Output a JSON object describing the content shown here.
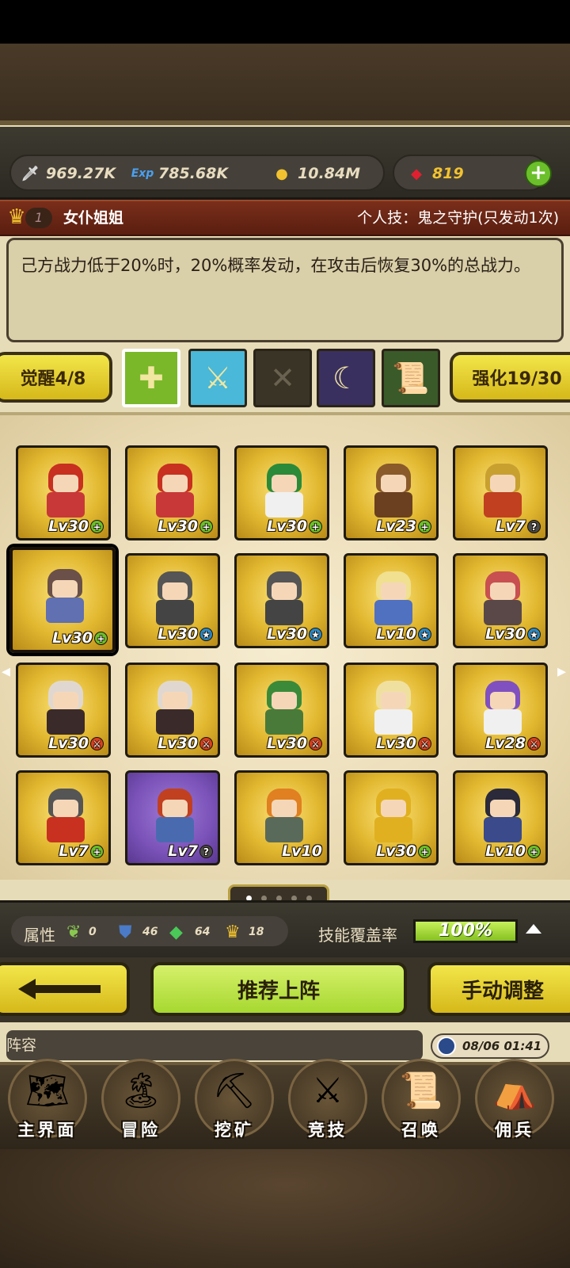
{
  "resources": {
    "power": "969.27K",
    "exp": "785.68K",
    "gold": "10.84M",
    "gems": "819",
    "power_icon": "sword-icon",
    "exp_icon": "exp-icon",
    "gold_icon": "coin-icon",
    "gem_icon": "ruby-icon"
  },
  "hero": {
    "rank": "1",
    "name": "女仆姐姐",
    "skill_title": "个人技：鬼之守护(只发动1次)",
    "description": "己方战力低于20%时，20%概率发动，在攻击后恢复30%的总战力。"
  },
  "awaken": {
    "label": "觉醒4/8"
  },
  "enhance": {
    "label": "强化19/30"
  },
  "skill_slots": [
    {
      "name": "golden-cross-icon",
      "color": "#7ab82a",
      "selected": true
    },
    {
      "name": "magic-sword-icon",
      "color": "#4ab8d8",
      "selected": false
    },
    {
      "name": "empty-slot-icon",
      "color": "#3a3426",
      "selected": false
    },
    {
      "name": "purple-horn-icon",
      "color": "#3a3060",
      "selected": false
    },
    {
      "name": "scroll-icon",
      "color": "#3a5a2a",
      "selected": false
    }
  ],
  "heroes": [
    {
      "lv": "Lv30",
      "badge": "plus",
      "hair": "#c83020",
      "body": "#c83838"
    },
    {
      "lv": "Lv30",
      "badge": "plus",
      "hair": "#c83020",
      "body": "#c83838"
    },
    {
      "lv": "Lv30",
      "badge": "plus",
      "hair": "#2a8a3a",
      "body": "#f0f0f0"
    },
    {
      "lv": "Lv23",
      "badge": "plus",
      "hair": "#8a5a2a",
      "body": "#6a4020"
    },
    {
      "lv": "Lv7",
      "badge": "question",
      "hair": "#c8a030",
      "body": "#c04020"
    },
    {
      "lv": "Lv30",
      "badge": "plus",
      "hair": "#6a5048",
      "body": "#6070b0"
    },
    {
      "lv": "Lv30",
      "badge": "star",
      "hair": "#555555",
      "body": "#444444"
    },
    {
      "lv": "Lv30",
      "badge": "star",
      "hair": "#555555",
      "body": "#444444"
    },
    {
      "lv": "Lv10",
      "badge": "star",
      "hair": "#f0e090",
      "body": "#5070c0"
    },
    {
      "lv": "Lv30",
      "badge": "star",
      "hair": "#c85050",
      "body": "#5a4848"
    },
    {
      "lv": "Lv30",
      "badge": "sword",
      "hair": "#e0d8d0",
      "body": "#3a2a2a"
    },
    {
      "lv": "Lv30",
      "badge": "sword",
      "hair": "#e0d8d0",
      "body": "#3a2a2a"
    },
    {
      "lv": "Lv30",
      "badge": "sword",
      "hair": "#3a8a3a",
      "body": "#4a7a3a"
    },
    {
      "lv": "Lv30",
      "badge": "sword",
      "hair": "#f0e0a0",
      "body": "#f0f0f0"
    },
    {
      "lv": "Lv28",
      "badge": "sword",
      "hair": "#8050c0",
      "body": "#f0f0f0"
    },
    {
      "lv": "Lv7",
      "badge": "plus",
      "hair": "#555555",
      "body": "#c83020"
    },
    {
      "lv": "Lv7",
      "badge": "question",
      "hair": "#c04020",
      "body": "#4a6ab0"
    },
    {
      "lv": "Lv10",
      "badge": "none",
      "hair": "#e08020",
      "body": "#5a6a5a"
    },
    {
      "lv": "Lv30",
      "badge": "plus",
      "hair": "#e0b020",
      "body": "#e0b020"
    },
    {
      "lv": "Lv10",
      "badge": "plus",
      "hair": "#2a2a3a",
      "body": "#3a4a8a"
    }
  ],
  "badge_colors": {
    "plus": "#6bbf2a",
    "star": "#2a8ac8",
    "sword": "#d84020",
    "question": "#4a4a4a"
  },
  "pager": {
    "pages": 5,
    "current": 0
  },
  "stats": {
    "attr_label": "属性",
    "attr1": "0",
    "attr2": "46",
    "attr3": "64",
    "attr4": "18",
    "coverage_label": "技能覆盖率",
    "coverage_value": "100%",
    "coverage_fraction": 1.0
  },
  "actions": {
    "back_icon": "back-arrow-icon",
    "recommend": "推荐上阵",
    "manual": "手动调整"
  },
  "lineup": {
    "label": "阵容",
    "time": "08/06 01:41"
  },
  "nav": [
    {
      "label": "主界面",
      "icon": "map-scroll-icon",
      "glyph": "🗺"
    },
    {
      "label": "冒险",
      "icon": "island-icon",
      "glyph": "🏝"
    },
    {
      "label": "挖矿",
      "icon": "pickaxe-icon",
      "glyph": "⛏"
    },
    {
      "label": "竞技",
      "icon": "crossed-swords-icon",
      "glyph": "⚔"
    },
    {
      "label": "召唤",
      "icon": "summon-scroll-icon",
      "glyph": "📜"
    },
    {
      "label": "佣兵",
      "icon": "tent-icon",
      "glyph": "⛺"
    }
  ]
}
